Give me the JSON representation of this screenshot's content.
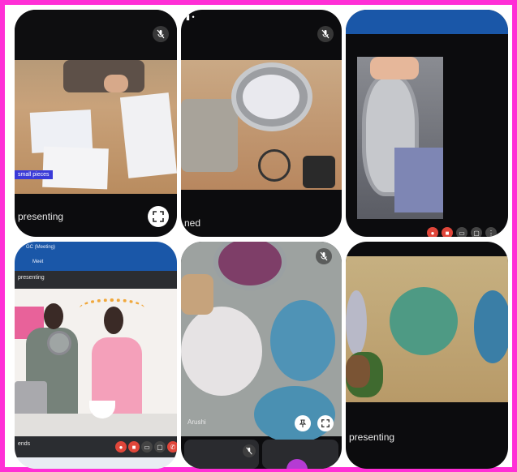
{
  "tiles": {
    "t1": {
      "caption": "small pieces",
      "status": "presenting"
    },
    "t2": {
      "status": "ned"
    },
    "t3": {},
    "t4": {
      "tab_title": "GC (Meeting)",
      "tab_sub": "Meet",
      "bar_text": "presenting",
      "footer_text": "ends"
    },
    "t5": {
      "participant": "Arushi"
    },
    "t6": {
      "status": "presenting"
    }
  },
  "colors": {
    "frame": "#ff2fd6",
    "tile_bg": "#0c0c0e",
    "end_call": "#e0463a",
    "meet_blue": "#1a57a8"
  },
  "icons": {
    "mic_off": "mic-off-icon",
    "fullscreen": "fullscreen-icon",
    "pin": "pin-icon",
    "more": "more-vert-icon"
  }
}
